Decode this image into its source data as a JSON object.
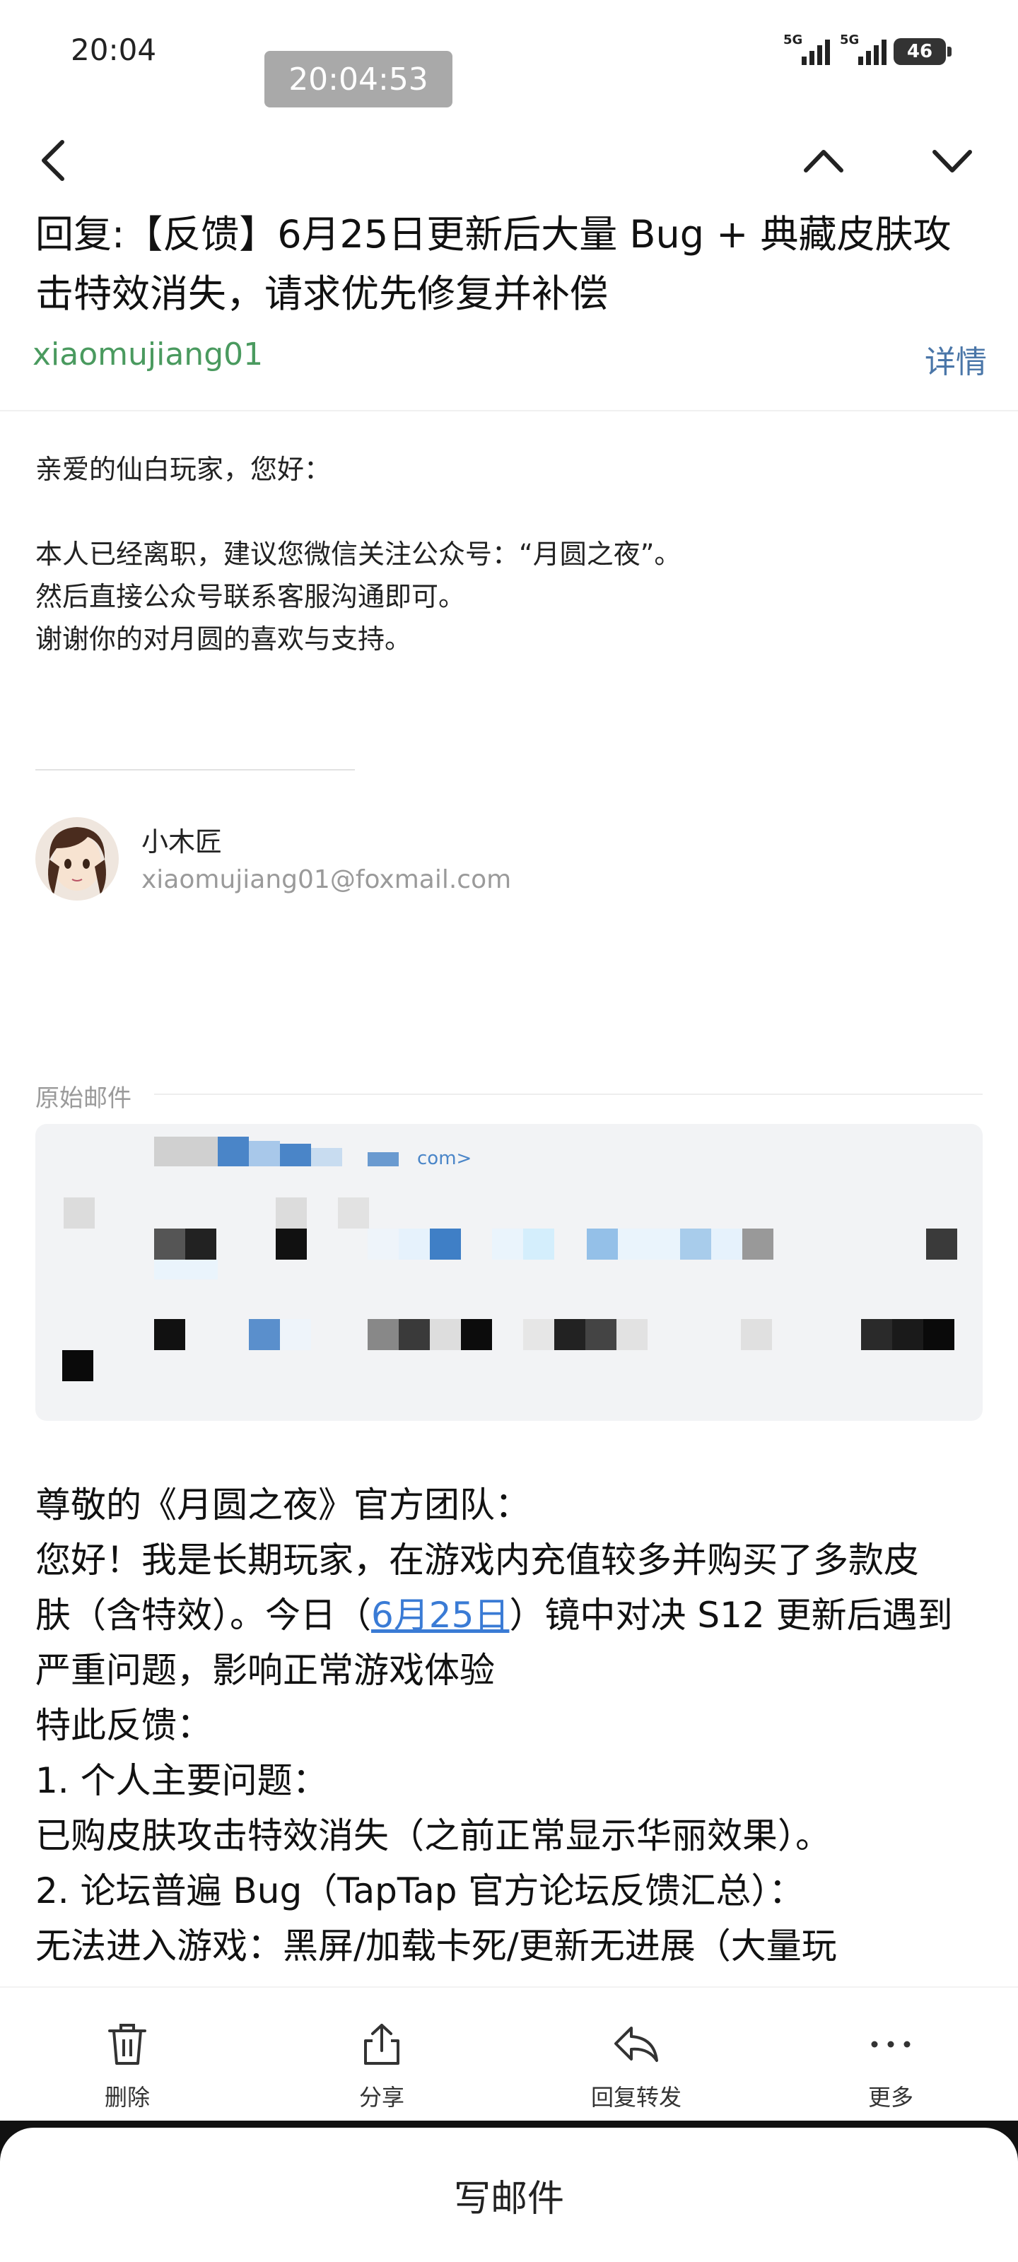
{
  "status_bar": {
    "time": "20:04",
    "pill_time": "20:04:53",
    "network_1": "5G",
    "network_2": "5G",
    "battery": "46"
  },
  "email": {
    "subject": "回复:【反馈】6月25日更新后大量 Bug + 典藏皮肤攻击特效消失，请求优先修复并补偿",
    "sender": "xiaomujiang01",
    "details_label": "详情",
    "reply_lines": [
      "亲爱的仙白玩家，您好：",
      "",
      "本人已经离职，建议您微信关注公众号：“月圆之夜”。",
      "然后直接公众号联系客服沟通即可。",
      "谢谢你的对月圆的喜欢与支持。"
    ],
    "signature": {
      "name": "小木匠",
      "email": "xiaomujiang01@foxmail.com"
    },
    "original_label": "原始邮件",
    "original_header_fragment": "com>",
    "original_body": {
      "l1": "尊敬的《月圆之夜》官方团队：",
      "l2": "您好！我是长期玩家，在游戏内充值较多并购买了多款皮",
      "l3_a": "肤（含特效）。今日（",
      "l3_link": "6月25日",
      "l3_b": "）镜中对决 S12 更新后遇到",
      "l4": "严重问题，影响正常游戏体验",
      "l5": "特此反馈：",
      "l6": "1. 个人主要问题：",
      "l7": "已购皮肤攻击特效消失（之前正常显示华丽效果）。",
      "l8": "2. 论坛普遍 Bug（TapTap 官方论坛反馈汇总）：",
      "l9": "无法进入游戏：黑屏/加载卡死/更新无进展（大量玩"
    }
  },
  "toolbar": {
    "delete": "删除",
    "share": "分享",
    "reply_forward": "回复转发",
    "more": "更多"
  },
  "compose": "写邮件"
}
